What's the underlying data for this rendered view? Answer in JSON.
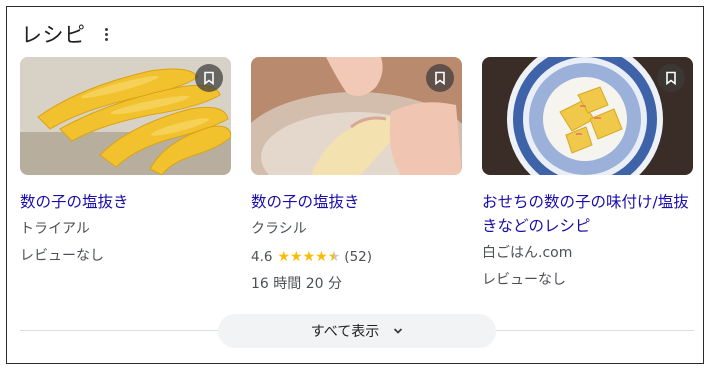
{
  "header": {
    "title": "レシピ",
    "more_icon": "more-vert-icon"
  },
  "cards": [
    {
      "title": "数の子の塩抜き",
      "source": "トライアル",
      "reviews": "レビューなし",
      "image": "yellow-kazunoko-on-tray"
    },
    {
      "title": "数の子の塩抜き",
      "source": "クラシル",
      "rating": "4.6",
      "stars": 4.6,
      "review_count": "(52)",
      "time": "16 時間 20 分",
      "image": "hands-rinsing-kazunoko"
    },
    {
      "title": "おせちの数の子の味付け/塩抜きなどのレシピ",
      "source": "白ごはん.com",
      "reviews": "レビューなし",
      "image": "kazunoko-in-blue-bowl"
    }
  ],
  "footer": {
    "show_all_label": "すべて表示",
    "chevron_icon": "chevron-down-icon"
  },
  "colors": {
    "link": "#1a0dab",
    "star": "#fbbc04",
    "secondary_text": "#4d5156"
  }
}
